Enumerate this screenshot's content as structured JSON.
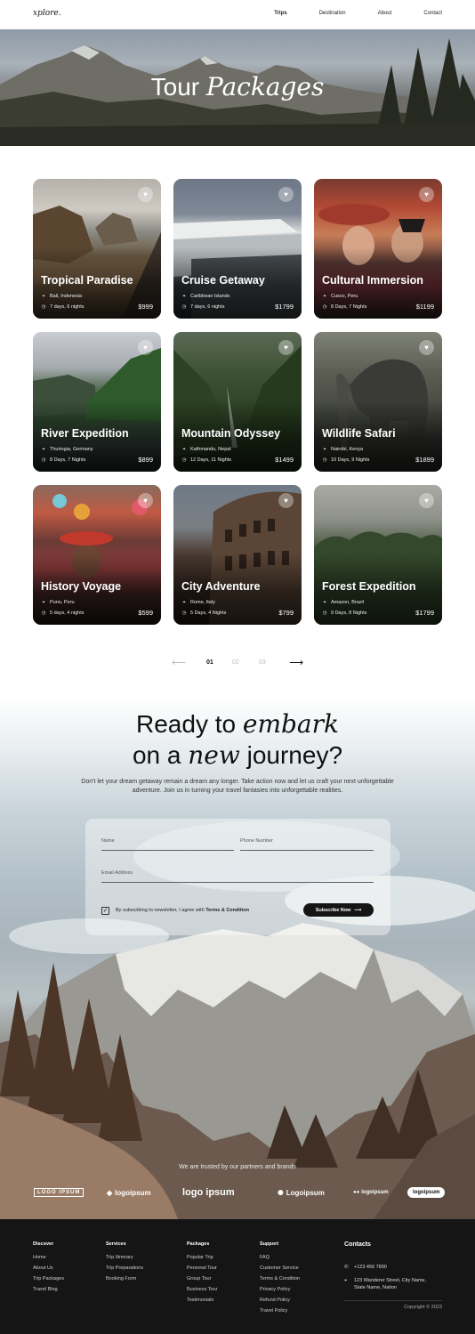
{
  "brand": {
    "logo": "xplore."
  },
  "nav": {
    "items": [
      {
        "label": "Trips",
        "active": true
      },
      {
        "label": "Destination",
        "active": false
      },
      {
        "label": "About",
        "active": false
      },
      {
        "label": "Contact",
        "active": false
      }
    ]
  },
  "hero": {
    "title_plain": "Tour",
    "title_italic": "Packages"
  },
  "packages": [
    {
      "title": "Tropical Paradise",
      "location": "Bali, Indonesia",
      "duration": "7 days, 6 nights",
      "price": "$999"
    },
    {
      "title": "Cruise Getaway",
      "location": "Caribbean Islands",
      "duration": "7 days, 6 nights",
      "price": "$1799"
    },
    {
      "title": "Cultural Immersion",
      "location": "Cusco, Peru",
      "duration": "8 Days, 7 Nights",
      "price": "$1199"
    },
    {
      "title": "River Expedition",
      "location": "Thuringia, Germany",
      "duration": "8 Days, 7 Nights",
      "price": "$899"
    },
    {
      "title": "Mountain Odyssey",
      "location": "Kathmandu, Nepal",
      "duration": "12 Days, 11 Nights",
      "price": "$1499"
    },
    {
      "title": "Wildlife Safari",
      "location": "Nairobi, Kenya",
      "duration": "10 Days, 9 Nights",
      "price": "$1899"
    },
    {
      "title": "History Voyage",
      "location": "Puno, Peru",
      "duration": "5 days, 4 nights",
      "price": "$599"
    },
    {
      "title": "City Adventure",
      "location": "Rome, Italy",
      "duration": "5 Days, 4 Nights",
      "price": "$799"
    },
    {
      "title": "Forest Expedition",
      "location": "Amazon, Brazil",
      "duration": "9 Days, 8 Nights",
      "price": "$1799"
    }
  ],
  "pagination": {
    "pages": [
      "01",
      "02",
      "03"
    ],
    "current": "01"
  },
  "cta": {
    "line1_plain": "Ready to",
    "line1_italic": "embark",
    "line2_a": "on a",
    "line2_italic": "new",
    "line2_b": "journey?",
    "paragraph": "Don't let your dream getaway remain a dream any longer. Take action now and let us craft your next unforgettable adventure. Join us in turning your travel fantasies into unforgettable realities.",
    "form": {
      "name_placeholder": "Name",
      "phone_placeholder": "Phone Number",
      "email_placeholder": "Email Address",
      "consent_text": "By subscribing to newsletter, I agree with",
      "consent_link": "Terms & Condition",
      "checkbox_checked": true,
      "submit_label": "Subscribe Now"
    },
    "trusted_text": "We are trusted by our partners and brands",
    "partners": [
      "LOGO IPSUM",
      "logoipsum",
      "logo ipsum",
      "Logoipsum",
      "logoipsum",
      "logoipsum"
    ]
  },
  "footer": {
    "columns": [
      {
        "heading": "Discover",
        "links": [
          "Home",
          "About Us",
          "Trip Packages",
          "Travel Blog"
        ]
      },
      {
        "heading": "Services",
        "links": [
          "Trip Itinerary",
          "Trip Preparations",
          "Booking Form"
        ]
      },
      {
        "heading": "Packages",
        "links": [
          "Popular Trip",
          "Personal Tour",
          "Group Tour",
          "Business Tour",
          "Testimonials"
        ]
      },
      {
        "heading": "Support",
        "links": [
          "FAQ",
          "Customer Service",
          "Terms & Condition",
          "Privacy Policy",
          "Refund Policy",
          "Travel Policy"
        ]
      }
    ],
    "contacts": {
      "heading": "Contacts",
      "phone": "+123 456 7890",
      "address_line1": "123 Wanderer Street, City Name,",
      "address_line2": "State Name, Nation"
    },
    "copyright": "Copyright © 2023"
  }
}
